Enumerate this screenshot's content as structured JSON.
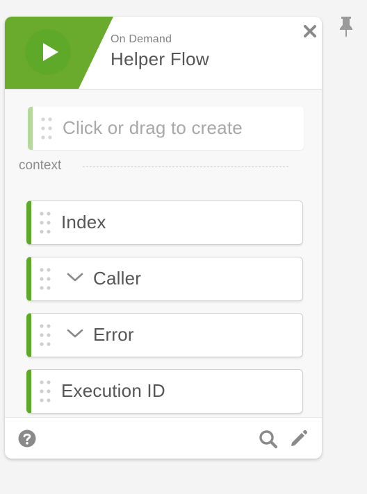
{
  "header": {
    "subtitle": "On Demand",
    "title": "Helper Flow",
    "play_icon": "play-icon",
    "close_icon": "close-icon",
    "pin_icon": "pin-icon"
  },
  "create_slot": {
    "label": "Click or drag to create"
  },
  "context": {
    "label": "context",
    "fields": [
      {
        "label": "Index",
        "expandable": false
      },
      {
        "label": "Caller",
        "expandable": true
      },
      {
        "label": "Error",
        "expandable": true
      },
      {
        "label": "Execution ID",
        "expandable": false
      }
    ]
  },
  "footer": {
    "help_icon": "help-icon",
    "search_icon": "search-icon",
    "edit_icon": "pencil-icon"
  },
  "colors": {
    "accent_green": "#5fa92a",
    "banner_green": "#6aab2e",
    "light_green": "#b6d89c",
    "icon_gray": "#8a8a8a"
  }
}
